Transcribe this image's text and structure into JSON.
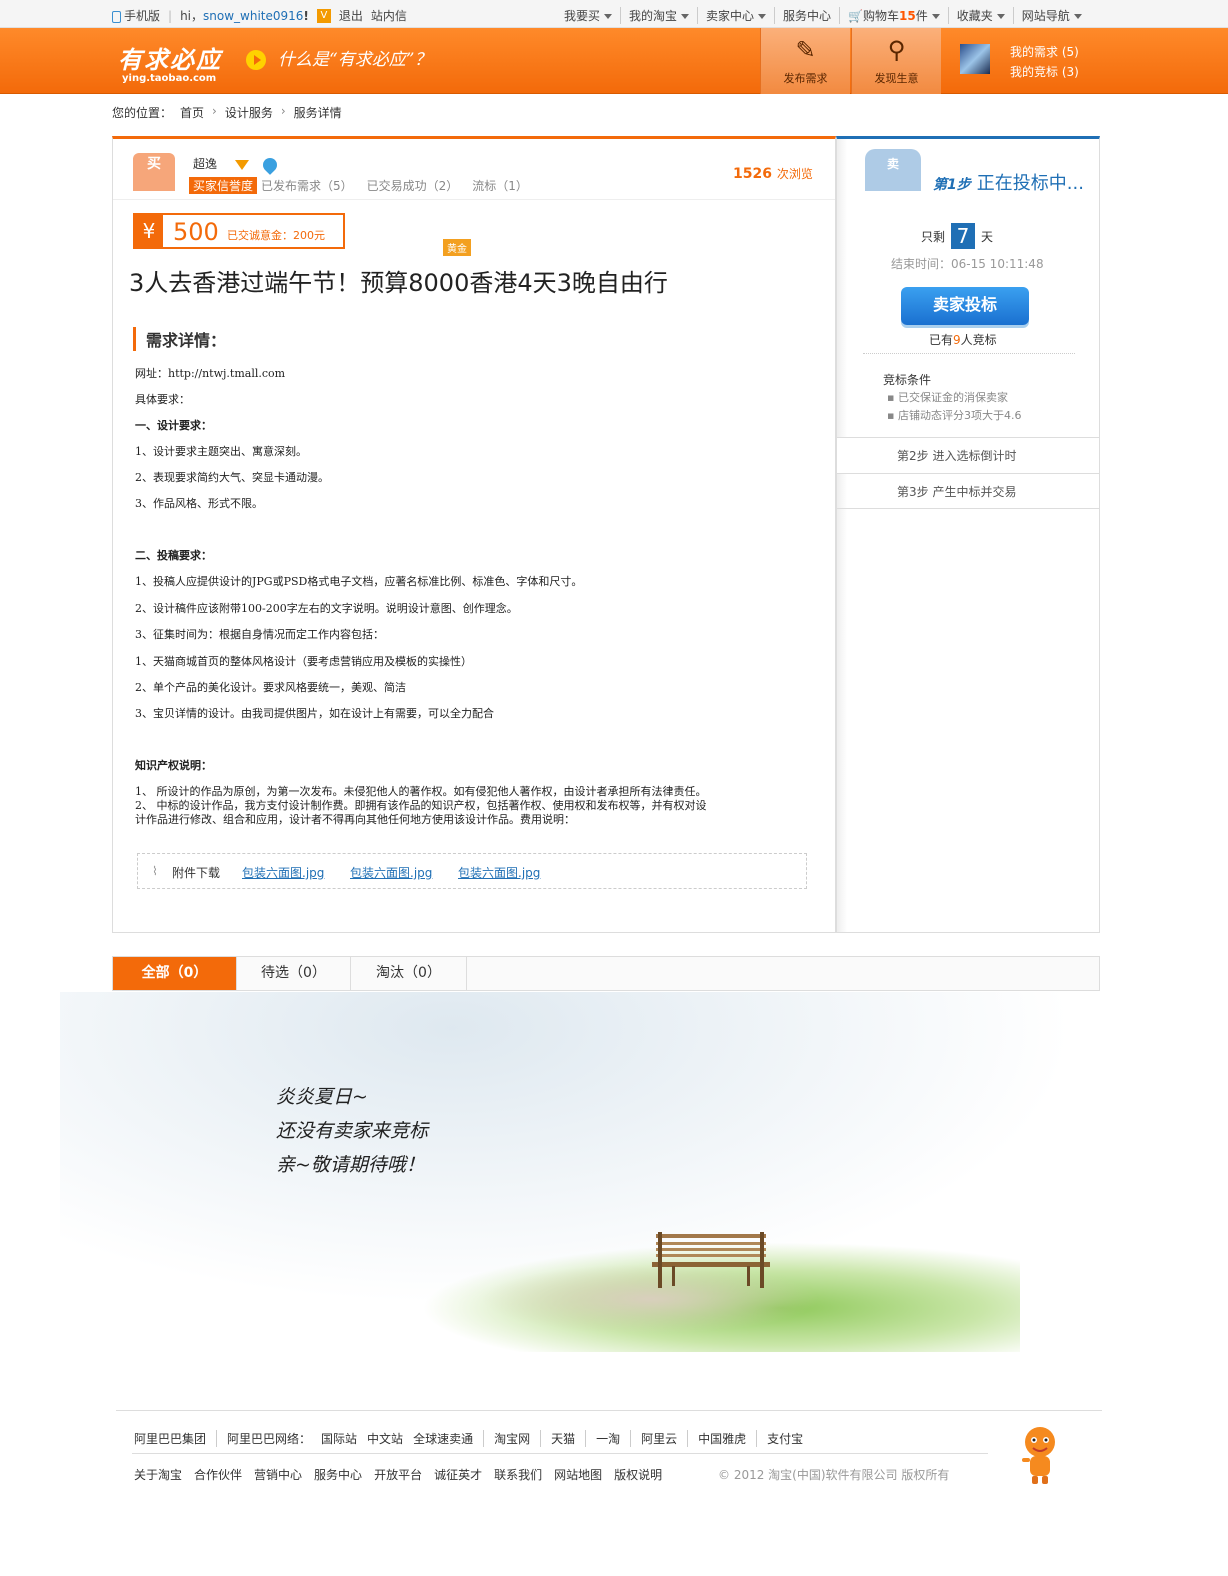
{
  "topbar": {
    "mobile": "手机版",
    "hi": "hi，",
    "username": "snow_white0916",
    "exclaim": "!",
    "logout": "退出",
    "inbox": "站内信",
    "nav": [
      {
        "label": "我要买",
        "caret": true
      },
      {
        "label": "我的淘宝",
        "caret": true
      },
      {
        "label": "卖家中心",
        "caret": true
      },
      {
        "label": "服务中心",
        "caret": false
      },
      {
        "label": "购物车",
        "count": "15",
        "unit": "件",
        "caret": true
      },
      {
        "label": "收藏夹",
        "caret": true
      },
      {
        "label": "网站导航",
        "caret": true
      }
    ]
  },
  "header": {
    "logo_main": "有求必应",
    "logo_sub": "ying.taobao.com",
    "slogan": "什么是“有求必应”？",
    "publish": "发布需求",
    "discover": "发现生意",
    "my_needs": "我的需求 (5)",
    "my_bids": "我的竞标 (3)"
  },
  "breadcrumb": {
    "prefix": "您的位置：",
    "items": [
      "首页",
      "设计服务",
      "服务详情"
    ]
  },
  "buyer": {
    "avatar_char": "买",
    "name": "超逸",
    "credit_tag": "买家信誉度",
    "published": "已发布需求（5）",
    "success": "已交易成功（2）",
    "failed": "流标（1）",
    "views_num": "1526",
    "views_unit": "次浏览"
  },
  "price": {
    "symbol": "¥",
    "amount": "500",
    "deposit": "已交诚意金：200元",
    "gold_tag": "黄金"
  },
  "title": "3人去香港过端午节！预算8000香港4天3晚自由行",
  "detail_heading": "需求详情：",
  "detail_lines": [
    {
      "text": "网址：http://ntwj.tmall.com",
      "bold": false
    },
    {
      "text": "具体要求：",
      "bold": false
    },
    {
      "text": "一、设计要求：",
      "bold": true
    },
    {
      "text": "1、设计要求主题突出、寓意深刻。",
      "bold": false
    },
    {
      "text": "2、表现要求简约大气、突显卡通动漫。",
      "bold": false
    },
    {
      "text": "3、作品风格、形式不限。",
      "bold": false
    },
    {
      "text": "二、投稿要求：",
      "bold": true
    },
    {
      "text": "1、投稿人应提供设计的JPG或PSD格式电子文档，应著名标准比例、标准色、字体和尺寸。",
      "bold": false
    },
    {
      "text": "2、设计稿件应该附带100-200字左右的文字说明。说明设计意图、创作理念。",
      "bold": false
    },
    {
      "text": "3、征集时间为：根据自身情况而定工作内容包括：",
      "bold": false
    },
    {
      "text": "1、天猫商城首页的整体风格设计（要考虑营销应用及模板的实操性）",
      "bold": false
    },
    {
      "text": "2、单个产品的美化设计。要求风格要统一，美观、简洁",
      "bold": false
    },
    {
      "text": "3、宝贝详情的设计。由我司提供图片，如在设计上有需要，可以全力配合",
      "bold": false
    },
    {
      "text": "知识产权说明：",
      "bold": true
    },
    {
      "text": "1、  所设计的作品为原创，为第一次发布。未侵犯他人的著作权。如有侵犯他人著作权，由设计者承担所有法律责任。",
      "bold": false
    },
    {
      "text": "2、  中标的设计作品，我方支付设计制作费。即拥有该作品的知识产权，包括著作权、使用权和发布权等，并有权对设",
      "bold": false
    },
    {
      "text": "计作品进行修改、组合和应用，设计者不得再向其他任何地方使用该设计作品。费用说明：",
      "bold": false
    }
  ],
  "attachments": {
    "label": "附件下载",
    "files": [
      "包装六面图.jpg",
      "包装六面图.jpg",
      "包装六面图.jpg"
    ]
  },
  "sidebar": {
    "seller_char": "卖",
    "step1_num": "第1步",
    "step1_text": "正在投标中...",
    "remain_pre": "只剩",
    "remain_days": "7",
    "remain_unit": "天",
    "end_time": "结束时间：06-15 10:11:48",
    "bid_button": "卖家投标",
    "bid_count_pre": "已有",
    "bid_count": "9",
    "bid_count_post": "人竞标",
    "cond_title": "竞标条件",
    "conditions": [
      "已交保证金的消保卖家",
      "店铺动态评分3项大于4.6"
    ],
    "step2": "第2步   进入选标倒计时",
    "step3": "第3步   产生中标并交易"
  },
  "tabs": [
    {
      "label": "全部（0）",
      "active": true
    },
    {
      "label": "待选（0）",
      "active": false
    },
    {
      "label": "淘汰（0）",
      "active": false
    }
  ],
  "empty": {
    "lines": [
      "炎炎夏日~",
      "还没有卖家来竞标",
      "亲~敬请期待哦！"
    ]
  },
  "footer": {
    "row1": [
      "阿里巴巴集团",
      "阿里巴巴网络：",
      "国际站",
      "中文站",
      "全球速卖通",
      "淘宝网",
      "天猫",
      "一淘",
      "阿里云",
      "中国雅虎",
      "支付宝"
    ],
    "row2": [
      "关于淘宝",
      "合作伙伴",
      "营销中心",
      "服务中心",
      "开放平台",
      "诚征英才",
      "联系我们",
      "网站地图",
      "版权说明"
    ],
    "copyright": "© 2012 淘宝(中国)软件有限公司 版权所有"
  },
  "colors": {
    "accent": "#f36a0a",
    "link": "#1f6fb5"
  }
}
